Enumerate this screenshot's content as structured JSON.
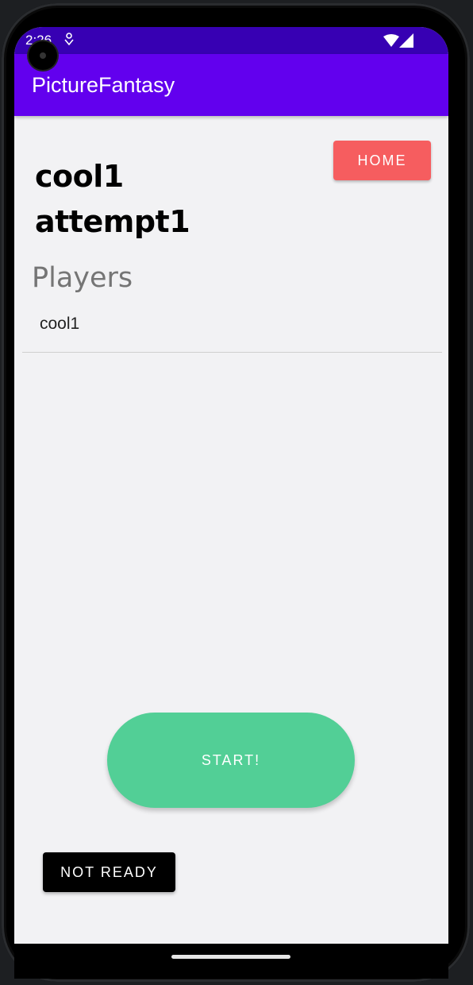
{
  "status_bar": {
    "time": "2:26",
    "icons": [
      "notification-icon",
      "wifi-icon",
      "signal-icon"
    ]
  },
  "app_bar": {
    "title": "PictureFantasy",
    "color": "#6200ee"
  },
  "room": {
    "title_line1": "cool1",
    "title_line2": "attempt1"
  },
  "home_button": {
    "label": "HOME",
    "color": "#f65d5f"
  },
  "players": {
    "heading": "Players",
    "items": [
      "cool1"
    ]
  },
  "start_button": {
    "label": "START!",
    "color": "#52cf96"
  },
  "not_ready_button": {
    "label": "NOT READY",
    "color": "#000000"
  }
}
